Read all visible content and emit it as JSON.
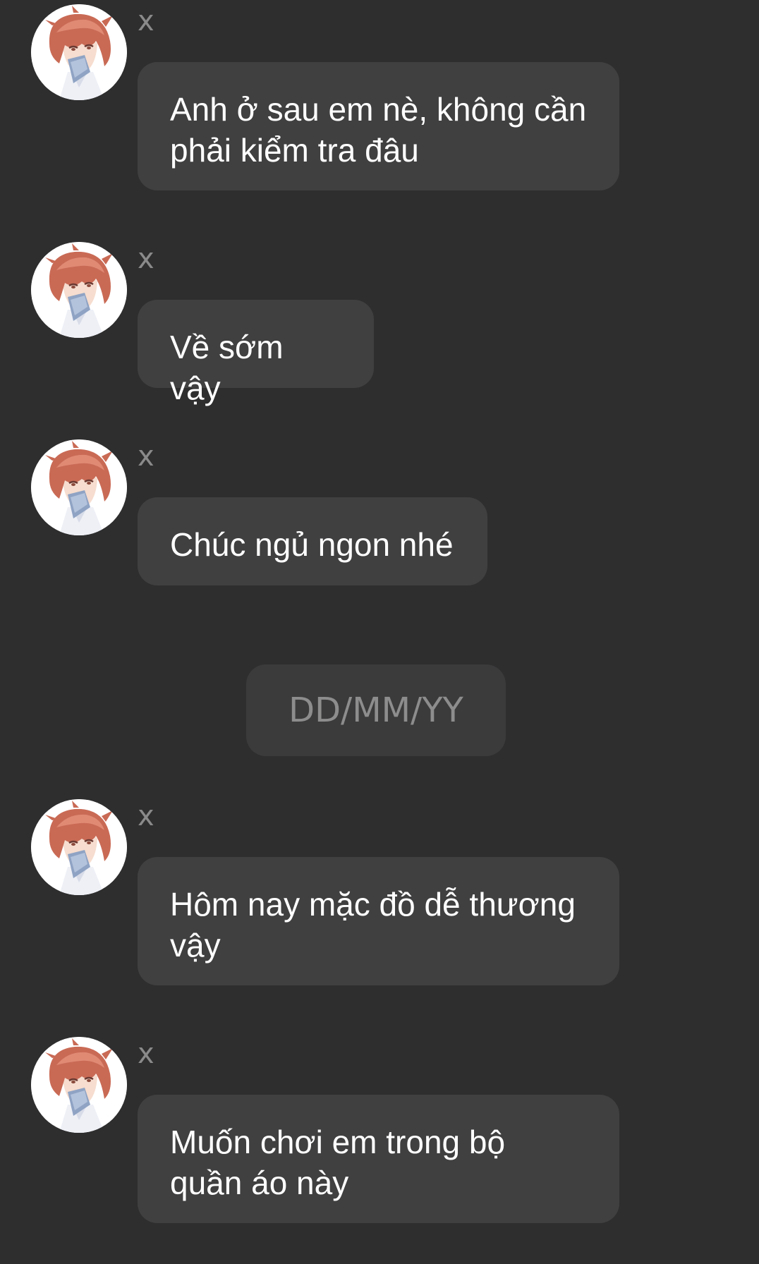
{
  "colors": {
    "background": "#2e2e2f",
    "bubble": "#404041",
    "date_bubble": "#3b3b3c",
    "sender_name": "#8a8a8a",
    "message_text": "#ffffff",
    "date_text": "#8d8d8d"
  },
  "avatar_icon": "anime-character-avatar-icon",
  "messages": [
    {
      "sender": "x",
      "text": "Anh ở sau em nè, không cần\nphải kiểm tra đâu"
    },
    {
      "sender": "x",
      "text": "Về sớm vậy"
    },
    {
      "sender": "x",
      "text": "Chúc ngủ ngon nhé"
    },
    {
      "sender": "x",
      "text": "Hôm nay mặc đồ dễ thương\nvậy"
    },
    {
      "sender": "x",
      "text": "Muốn chơi em trong bộ\nquần áo này"
    }
  ],
  "date_divider": {
    "label": "DD/MM/YY"
  }
}
